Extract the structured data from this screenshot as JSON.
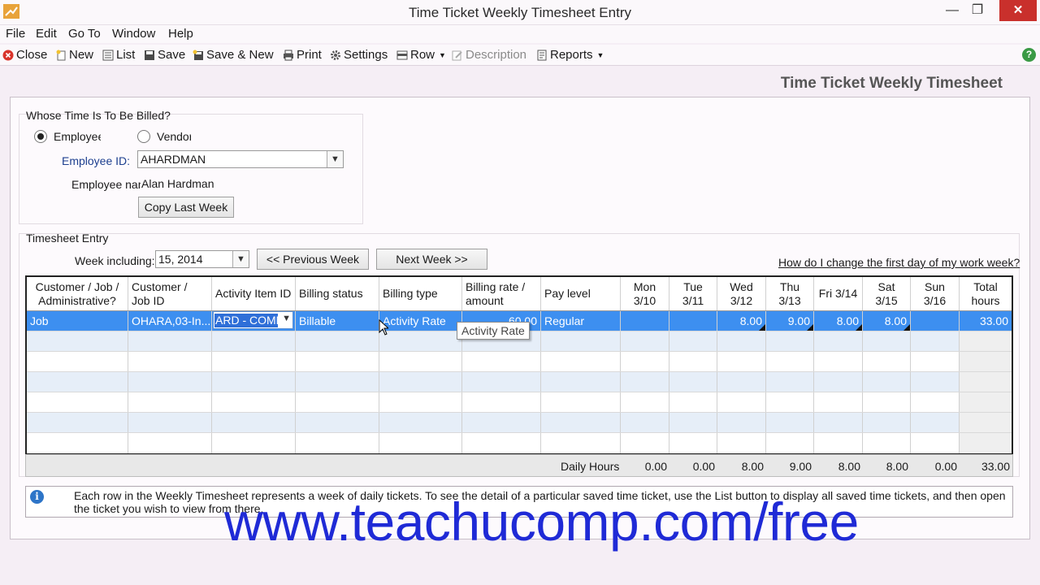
{
  "window": {
    "title": "Time Ticket Weekly Timesheet Entry",
    "min": "—",
    "max": "❐",
    "close": "✕"
  },
  "menu": [
    "File",
    "Edit",
    "Go To",
    "Window",
    "Help"
  ],
  "toolbar": {
    "close": "Close",
    "new": "New",
    "list": "List",
    "save": "Save",
    "save_new": "Save & New",
    "print": "Print",
    "settings": "Settings",
    "row": "Row",
    "description": "Description",
    "reports": "Reports"
  },
  "heading": "Time Ticket Weekly Timesheet",
  "whose": {
    "legend": "Whose Time Is To Be Billed?",
    "employee_option": "Employee",
    "vendor_option": "Vendor",
    "employee_id_label": "Employee ID:",
    "employee_id_value": "AHARDMAN",
    "employee_name_label": "Employee nar",
    "employee_name_value": "Alan Hardman",
    "copy_button": "Copy Last Week"
  },
  "timesheet": {
    "legend": "Timesheet Entry",
    "week_label": "Week including:",
    "week_value": "15, 2014",
    "prev_button": "<< Previous Week",
    "next_button": "Next Week >>",
    "help_link": "How do I change the first day of my work week?"
  },
  "grid": {
    "headers": [
      "Customer / Job / Administrative?",
      "Customer / Job ID",
      "Activity Item ID",
      "Billing status",
      "Billing type",
      "Billing rate / amount",
      "Pay level",
      "Mon 3/10",
      "Tue 3/11",
      "Wed 3/12",
      "Thu 3/13",
      "Fri 3/14",
      "Sat 3/15",
      "Sun 3/16",
      "Total hours"
    ],
    "row1": {
      "kind": "Job",
      "job_id": "OHARA,03-In...",
      "activity": "ARD - COMM",
      "status": "Billable",
      "type": "Activity Rate",
      "rate": "60.00",
      "pay": "Regular",
      "mon": "",
      "tue": "",
      "wed": "8.00",
      "thu": "9.00",
      "fri": "8.00",
      "sat": "8.00",
      "sun": "",
      "total": "33.00"
    },
    "tooltip": "Activity Rate",
    "daily_label": "Daily Hours",
    "daily": [
      "0.00",
      "0.00",
      "8.00",
      "9.00",
      "8.00",
      "8.00",
      "0.00",
      "33.00"
    ]
  },
  "info": "Each row in the Weekly Timesheet represents a week of daily tickets. To see the detail of a particular saved time ticket, use the List button to display all saved time tickets, and then open the ticket you wish to view from there.",
  "watermark": "www.teachucomp.com/free"
}
